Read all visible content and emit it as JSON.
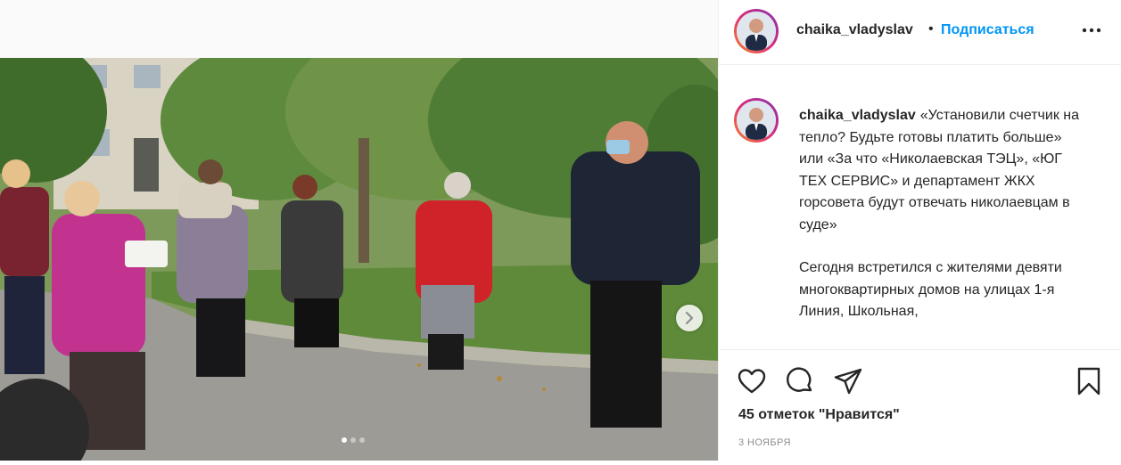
{
  "post": {
    "username": "chaika_vladyslav",
    "separator": "•",
    "follow_label": "Подписаться",
    "caption_paragraphs": [
      "«Установили счетчик на тепло? Будьте готовы платить больше» или «За что «Николаевская ТЭЦ», «ЮГ ТЕХ СЕРВИС» и департамент ЖКХ горсовета будут отвечать николаевцам в суде»",
      "Сегодня встретился с жителями девяти многоквартирных домов на улицах 1-я Линия, Школьная,"
    ],
    "likes_text": "45 отметок \"Нравится\"",
    "date_text": "3 ноября"
  },
  "carousel": {
    "slide_count": 3,
    "active_slide": 1
  },
  "icons": {
    "like": "heart-icon",
    "comment": "comment-icon",
    "share": "paper-plane-icon",
    "save": "bookmark-icon",
    "more": "more-options-icon",
    "next": "chevron-right-icon"
  },
  "colors": {
    "follow_link": "#0095f6",
    "text": "#262626",
    "secondary_text": "#8e8e8e",
    "border": "#efefef"
  }
}
